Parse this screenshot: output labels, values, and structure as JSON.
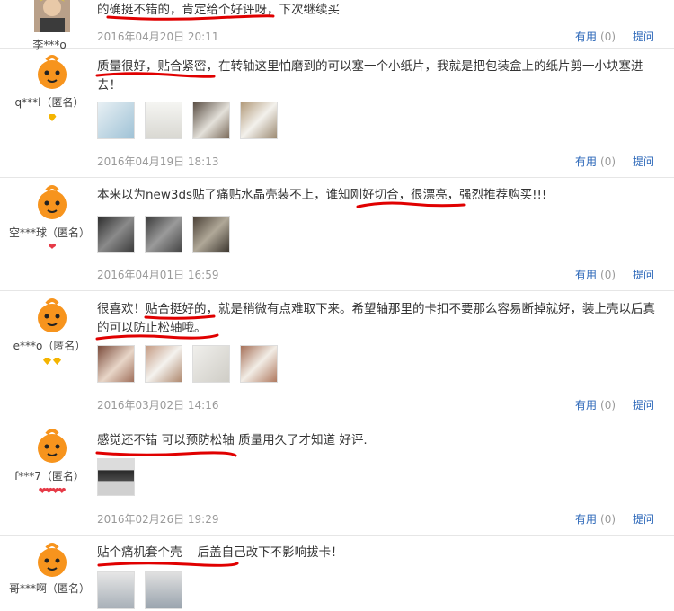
{
  "reviews": [
    {
      "user": "李***o",
      "avatar": "photo",
      "badges": [],
      "text": "的确挺不错的，肯定给个好评呀，下次继续买",
      "thumbs": [],
      "date": "2016年04月20日 20:11",
      "useful_label": "有用",
      "useful_count": "(0)",
      "ask_label": "提问"
    },
    {
      "user": "q***l（匿名）",
      "avatar": "orange-mascot",
      "badges": [
        "diamond"
      ],
      "text": "质量很好，贴合紧密，在转轴这里怕磨到的可以塞一个小纸片，我就是把包装盒上的纸片剪一小块塞进去！",
      "thumbs": [
        "photo-1",
        "photo-2",
        "photo-3",
        "photo-4"
      ],
      "date": "2016年04月19日 18:13",
      "useful_label": "有用",
      "useful_count": "(0)",
      "ask_label": "提问"
    },
    {
      "user": "空***球（匿名）",
      "avatar": "orange-mascot",
      "badges": [
        "heart"
      ],
      "text": "本来以为new3ds贴了痛贴水晶壳装不上，谁知刚好切合，很漂亮，强烈推荐购买!!!",
      "thumbs": [
        "photo-1",
        "photo-2",
        "photo-3"
      ],
      "date": "2016年04月01日 16:59",
      "useful_label": "有用",
      "useful_count": "(0)",
      "ask_label": "提问"
    },
    {
      "user": "e***o（匿名）",
      "avatar": "orange-mascot",
      "badges": [
        "diamond",
        "diamond"
      ],
      "text": "很喜欢！贴合挺好的，就是稍微有点难取下来。希望轴那里的卡扣不要那么容易断掉就好，装上壳以后真的可以防止松轴哦。",
      "thumbs": [
        "photo-1",
        "photo-2",
        "photo-3",
        "photo-4"
      ],
      "date": "2016年03月02日 14:16",
      "useful_label": "有用",
      "useful_count": "(0)",
      "ask_label": "提问"
    },
    {
      "user": "f***7（匿名）",
      "avatar": "orange-mascot",
      "badges": [
        "heart",
        "heart",
        "heart",
        "heart"
      ],
      "text": "感觉还不错 可以预防松轴 质量用久了才知道 好评.",
      "thumbs": [
        "photo-1"
      ],
      "date": "2016年02月26日 19:29",
      "useful_label": "有用",
      "useful_count": "(0)",
      "ask_label": "提问"
    },
    {
      "user": "哥***啊（匿名）",
      "avatar": "orange-mascot",
      "badges": [],
      "text": "贴个痛机套个壳    后盖自己改下不影响拔卡！",
      "thumbs": [
        "photo-1",
        "photo-2"
      ],
      "date": "",
      "useful_label": "",
      "useful_count": "",
      "ask_label": ""
    }
  ],
  "colors": {
    "link": "#2a66b8",
    "date": "#999999",
    "underline": "#e00000",
    "mascot": "#f7941d"
  }
}
